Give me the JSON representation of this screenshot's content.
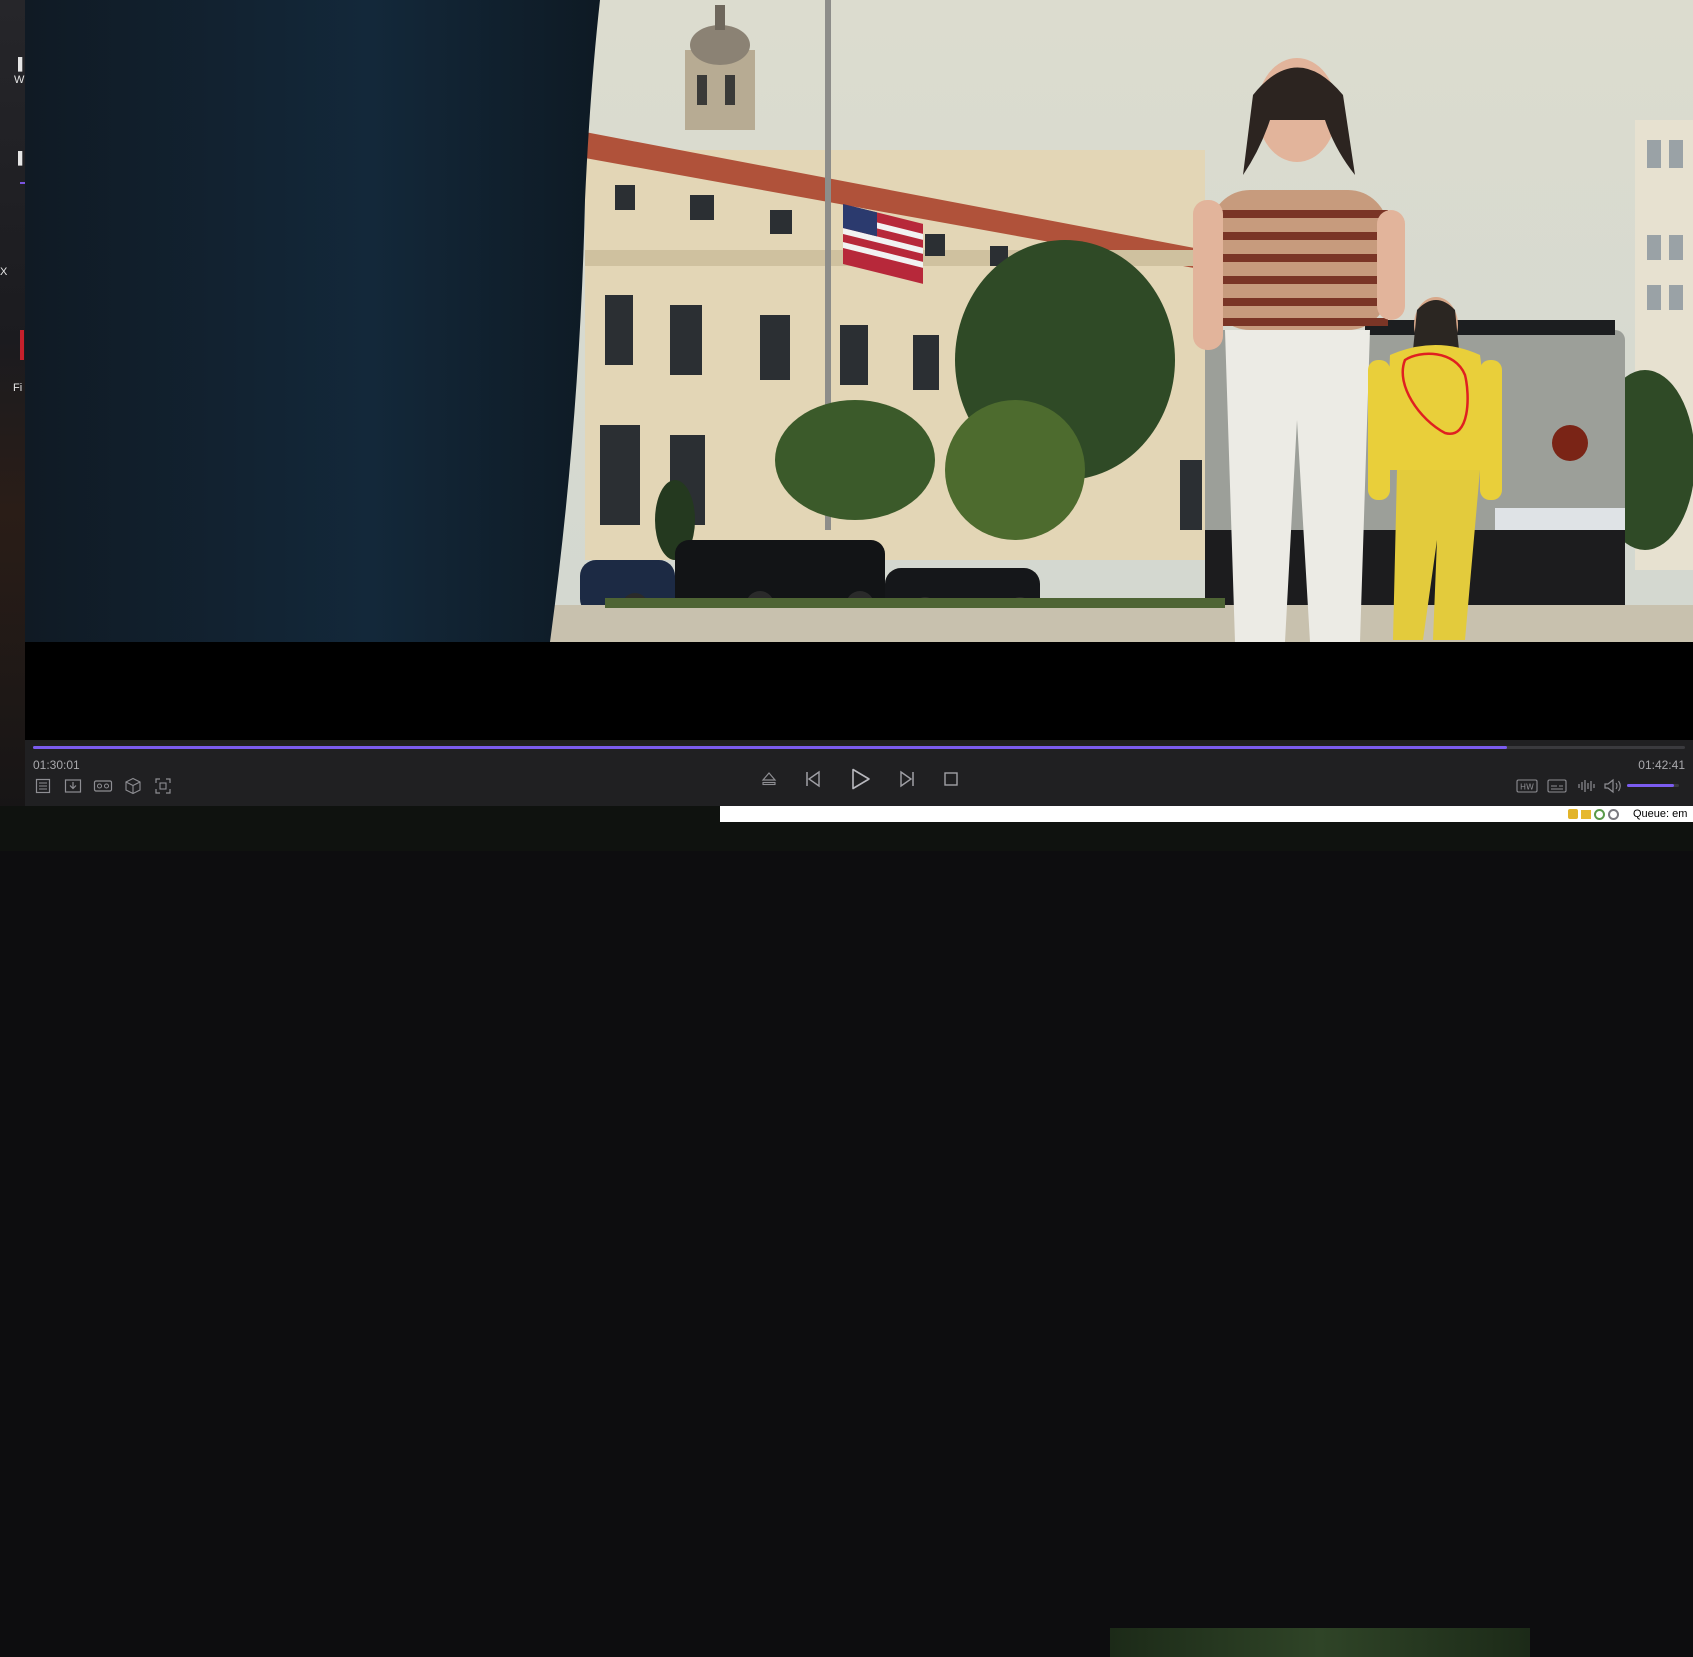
{
  "player": {
    "time_current": "01:30:01",
    "time_total": "01:42:41",
    "progress_fraction": 0.8925,
    "volume_fraction": 0.9
  },
  "controls": {
    "left": [
      {
        "name": "playlist-icon"
      },
      {
        "name": "download-icon"
      },
      {
        "name": "vr-headset-icon"
      },
      {
        "name": "3d-cube-icon"
      },
      {
        "name": "screenshot-icon"
      }
    ],
    "center": [
      {
        "name": "eject-icon"
      },
      {
        "name": "previous-icon"
      },
      {
        "name": "play-icon"
      },
      {
        "name": "next-icon"
      },
      {
        "name": "stop-icon"
      }
    ],
    "right": [
      {
        "name": "hw-decode-icon",
        "label": "HW"
      },
      {
        "name": "subtitles-icon"
      },
      {
        "name": "audio-waveform-icon"
      },
      {
        "name": "volume-icon"
      }
    ]
  },
  "status_bar": {
    "queue_text": "Queue: em"
  },
  "desktop": {
    "glyphs": [
      "W",
      "X",
      "Fi"
    ]
  },
  "colors": {
    "accent": "#7b5cf0",
    "control_bar": "#202022",
    "annotation": "#e02020"
  }
}
